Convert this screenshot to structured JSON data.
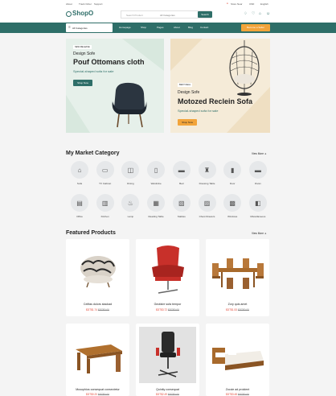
{
  "topbar": {
    "links": [
      "About",
      "Track Order",
      "Support"
    ],
    "store": "Store Near",
    "currency": "USD",
    "language": "English"
  },
  "header": {
    "logo": "ShopO",
    "search_placeholder": "Search Product",
    "category_select": "All Categories",
    "search_btn": "Search"
  },
  "nav": {
    "categories_btn": "All Categories",
    "items": [
      "Homepage",
      "Shop",
      "Pages",
      "About",
      "Blog",
      "Contact"
    ],
    "become_seller": "Become a Seller"
  },
  "hero1": {
    "badge": "NEW RELEASE",
    "kicker": "Design Sofe",
    "title": "Pouf Ottomans cloth",
    "subtitle": "Special-shaped sofa for sale",
    "btn": "Shop Now"
  },
  "hero2": {
    "badge": "BEST DEAL",
    "kicker": "Design Sofe",
    "title": "Motozed Reclein Sofa",
    "subtitle": "Special-shaped sofa for sale",
    "btn": "Shop Now"
  },
  "market": {
    "title": "My Market Category",
    "view_more": "View More",
    "row1": [
      "Sofa",
      "TV Cabinet",
      "Dining",
      "Wardrobe",
      "Bed",
      "Dressing Table",
      "Door",
      "Divan"
    ],
    "row2": [
      "Office",
      "Kitchen",
      "Lamp",
      "Reading Table",
      "Stables",
      "Chest Drawers",
      "Windows",
      "Miscellaneous"
    ]
  },
  "featured": {
    "title": "Featured Products",
    "view_more": "View More",
    "products": [
      {
        "name": "Celifas dolors stackad",
        "price": "$DT$1.74",
        "old": "$DT$0.00"
      },
      {
        "name": "Geofaire sufa tempor",
        "price": "$DT$3.72",
        "old": "$DT$0.00"
      },
      {
        "name": "Zory quis amet",
        "price": "$DT$1.53",
        "old": "$DT$0.00"
      },
      {
        "name": "Musophios consequat consectetur",
        "price": "$DT$0.20",
        "old": "$DT$0.00"
      },
      {
        "name": "Quinity consequat",
        "price": "$DT$2.49",
        "old": "$DT$0.00"
      },
      {
        "name": "Zoccie ad proident",
        "price": "$DT$3.48",
        "old": "$DT$0.00"
      }
    ]
  },
  "colors": {
    "primary": "#2e6e68",
    "accent": "#f2a43a",
    "price": "#e34a3a"
  }
}
